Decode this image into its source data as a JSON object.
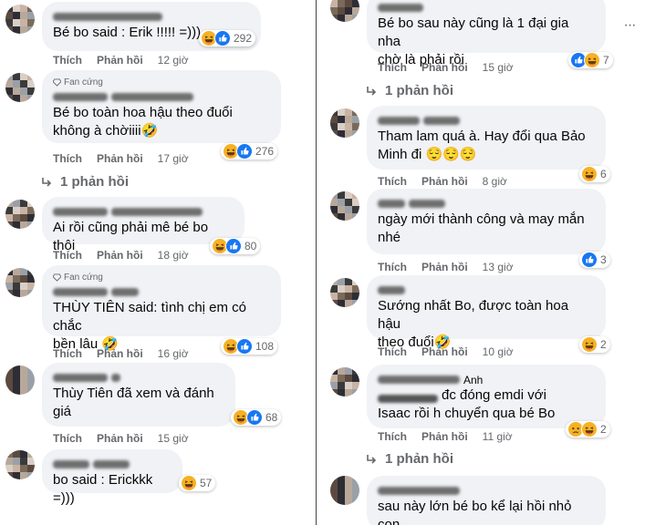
{
  "ui": {
    "like_label": "Thích",
    "reply_label": "Phản hồi",
    "fan_badge": "Fan cứng"
  },
  "left": [
    {
      "text": "Bé bo said : Erik !!!!! =)))",
      "time": "12 giờ",
      "count": "292",
      "fan": false,
      "reacts": [
        "haha",
        "like"
      ],
      "replies": ""
    },
    {
      "text": "Bé bo toàn hoa hậu theo đuổi\nkhông à chờiiii🤣",
      "time": "17 giờ",
      "count": "276",
      "fan": true,
      "reacts": [
        "haha",
        "like"
      ],
      "replies": "1 phản hồi"
    },
    {
      "text": "Ai rồi cũng phải mê bé bo thôi",
      "time": "18 giờ",
      "count": "80",
      "fan": false,
      "reacts": [
        "haha",
        "like"
      ],
      "replies": ""
    },
    {
      "text": "THÙY TIÊN said: tình chị em có chắc\nbền lâu 🤣",
      "time": "16 giờ",
      "count": "108",
      "fan": true,
      "reacts": [
        "haha",
        "like"
      ],
      "replies": ""
    },
    {
      "text": "Thùy Tiên đã xem và đánh\ngiá",
      "time": "15 giờ",
      "count": "68",
      "fan": false,
      "reacts": [
        "haha",
        "like"
      ],
      "replies": ""
    },
    {
      "text": "bo said : Erickkk =)))",
      "time": "",
      "count": "57",
      "fan": false,
      "reacts": [
        "haha"
      ],
      "replies": ""
    }
  ],
  "right": [
    {
      "text": "Bé bo sau này cũng là 1 đại gia nha\nchờ là phải rồi",
      "time": "15 giờ",
      "count": "7",
      "reacts": [
        "like",
        "haha"
      ],
      "replies": "1 phản hồi",
      "name_visible": ""
    },
    {
      "text": "Tham lam quá à. Hay đổi qua Bảo\nMinh đi 😌😌😌",
      "time": "8 giờ",
      "count": "6",
      "reacts": [
        "haha"
      ],
      "replies": "",
      "name_visible": ""
    },
    {
      "text": "ngày mới thành công và may mắn\nnhé",
      "time": "13 giờ",
      "count": "3",
      "reacts": [
        "like"
      ],
      "replies": "",
      "name_visible": ""
    },
    {
      "text": "Sướng nhất Bo, được toàn hoa hậu\ntheo đuổi🤣",
      "time": "10 giờ",
      "count": "2",
      "reacts": [
        "haha"
      ],
      "replies": "",
      "name_visible": ""
    },
    {
      "text": "đc đóng emdi với\nIsaac rồi h chuyển qua bé Bo",
      "time": "11 giờ",
      "count": "2",
      "reacts": [
        "sad",
        "haha"
      ],
      "replies": "1 phản hồi",
      "name_visible": "Anh"
    },
    {
      "text": "sau này lớn bé bo kể lại hồi nhỏ con",
      "time": "",
      "count": "",
      "reacts": [],
      "replies": "",
      "name_visible": ""
    }
  ],
  "colors": {
    "bubble": "#f0f2f5",
    "meta": "#65676b",
    "text": "#050505",
    "like_blue": "#1877f2",
    "haha_yellow": "#f7b125"
  }
}
